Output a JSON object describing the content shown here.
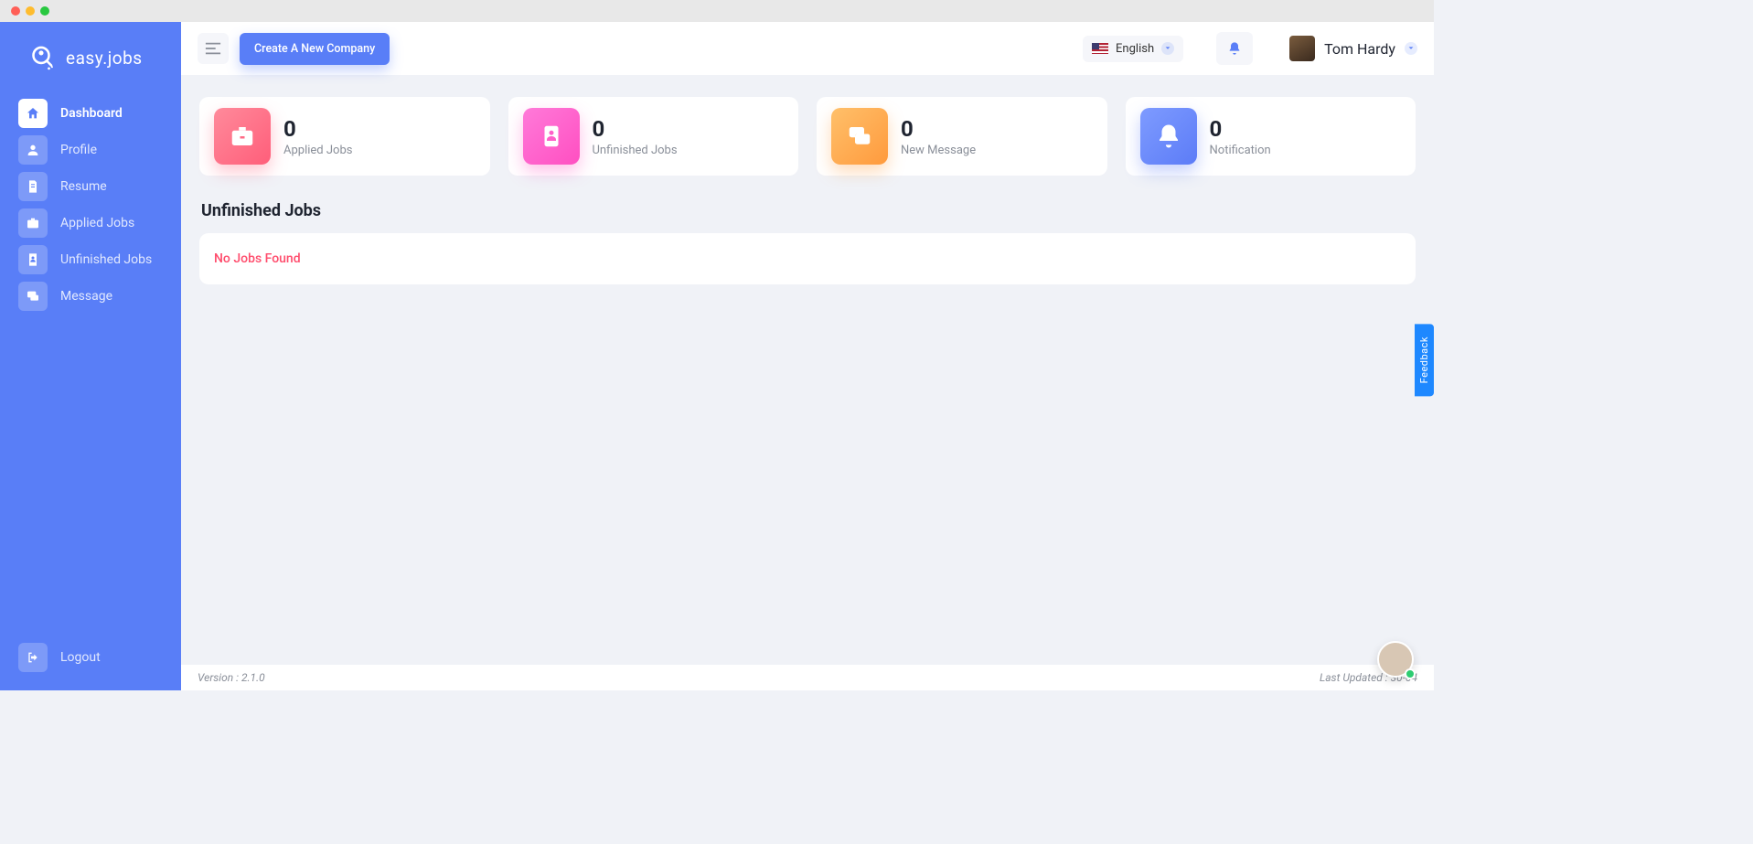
{
  "app": {
    "name": "easy.jobs"
  },
  "header": {
    "create_company": "Create A New Company",
    "language": "English",
    "user_name": "Tom Hardy"
  },
  "sidebar": {
    "items": [
      {
        "key": "dashboard",
        "label": "Dashboard",
        "active": true
      },
      {
        "key": "profile",
        "label": "Profile"
      },
      {
        "key": "resume",
        "label": "Resume"
      },
      {
        "key": "applied",
        "label": "Applied Jobs"
      },
      {
        "key": "unfinished",
        "label": "Unfinished Jobs"
      },
      {
        "key": "message",
        "label": "Message"
      }
    ],
    "logout": "Logout"
  },
  "cards": [
    {
      "value": "0",
      "label": "Applied Jobs"
    },
    {
      "value": "0",
      "label": "Unfinished Jobs"
    },
    {
      "value": "0",
      "label": "New Message"
    },
    {
      "value": "0",
      "label": "Notification"
    }
  ],
  "section": {
    "title": "Unfinished Jobs",
    "empty": "No Jobs Found"
  },
  "footer": {
    "version": "Version : 2.1.0",
    "updated": "Last Updated : 30-04"
  },
  "feedback": "Feedback"
}
